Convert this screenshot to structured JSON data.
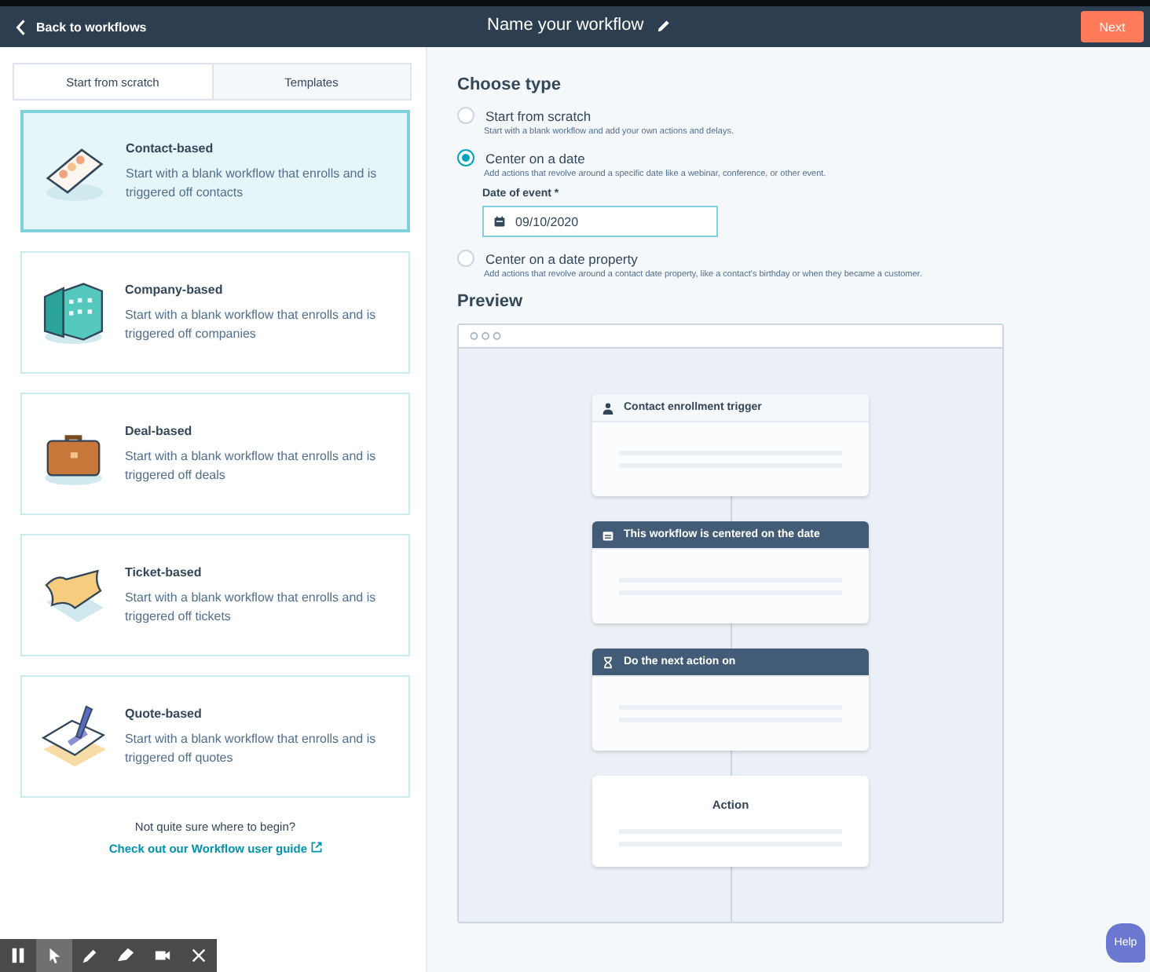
{
  "header": {
    "back": "Back to workflows",
    "title": "Name your workflow",
    "next": "Next"
  },
  "tabs": [
    {
      "label": "Start from scratch",
      "selected": true
    },
    {
      "label": "Templates",
      "selected": false
    }
  ],
  "cards": [
    {
      "kind": "contact",
      "title": "Contact-based",
      "text": "Start with a blank workflow that enrolls and is triggered off contacts",
      "selected": true
    },
    {
      "kind": "company",
      "title": "Company-based",
      "text": "Start with a blank workflow that enrolls and is triggered off companies",
      "selected": false
    },
    {
      "kind": "deal",
      "title": "Deal-based",
      "text": "Start with a blank workflow that enrolls and is triggered off deals",
      "selected": false
    },
    {
      "kind": "ticket",
      "title": "Ticket-based",
      "text": "Start with a blank workflow that enrolls and is triggered off tickets",
      "selected": false
    },
    {
      "kind": "quote",
      "title": "Quote-based",
      "text": "Start with a blank workflow that enrolls and is triggered off quotes",
      "selected": false
    }
  ],
  "help_text": "Not quite sure where to begin?",
  "guide_link": "Check out our Workflow user guide",
  "choose_type": {
    "heading": "Choose type",
    "options": [
      {
        "label": "Start from scratch",
        "description": "Start with a blank workflow and add your own actions and delays.",
        "selected": false
      },
      {
        "label": "Center on a date",
        "description": "Add actions that revolve around a specific date like a webinar, conference, or other event.",
        "selected": true,
        "field": {
          "label": "Date of event *",
          "value": "09/10/2020"
        }
      },
      {
        "label": "Center on a date property",
        "description": "Add actions that revolve around a contact date property, like a contact's birthday or when they became a customer.",
        "selected": false
      }
    ]
  },
  "preview": {
    "heading": "Preview",
    "nodes": [
      {
        "kind": "trigger",
        "title": "Contact enrollment trigger"
      },
      {
        "kind": "date",
        "title": "This workflow is centered on the date"
      },
      {
        "kind": "delay",
        "title": "Do the next action on"
      },
      {
        "kind": "action",
        "title": "Action"
      }
    ]
  },
  "toolbar": [
    {
      "kind": "pause",
      "selected": false
    },
    {
      "kind": "pointer",
      "selected": true
    },
    {
      "kind": "pen",
      "selected": false
    },
    {
      "kind": "marker",
      "selected": false
    },
    {
      "kind": "camera",
      "selected": false
    },
    {
      "kind": "close",
      "selected": false
    }
  ],
  "help_button": "Help"
}
